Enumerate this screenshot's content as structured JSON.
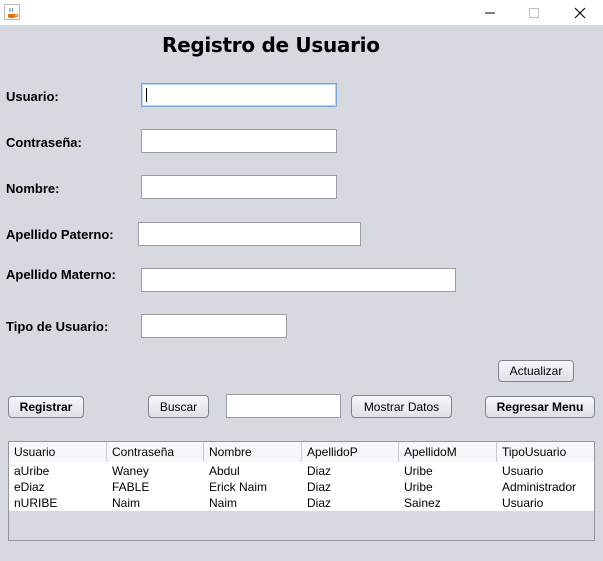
{
  "window": {
    "icon": "java-coffee-icon",
    "controls": [
      "minimize-icon",
      "maximize-icon",
      "close-icon"
    ]
  },
  "title": "Registro de Usuario",
  "form": {
    "usuario_label": "Usuario:",
    "usuario_value": "",
    "contrasena_label": "Contraseña:",
    "contrasena_value": "",
    "nombre_label": "Nombre:",
    "nombre_value": "",
    "apellido_paterno_label": "Apellido Paterno:",
    "apellido_paterno_value": "",
    "apellido_materno_label": "Apellido Materno:",
    "apellido_materno_value": "",
    "tipo_label": "Tipo de Usuario:",
    "tipo_value": "",
    "buscar_value": ""
  },
  "buttons": {
    "actualizar": "Actualizar",
    "registrar": "Registrar",
    "buscar": "Buscar",
    "mostrar": "Mostrar Datos",
    "regresar": "Regresar Menu"
  },
  "table": {
    "headers": [
      "Usuario",
      "Contraseña",
      "Nombre",
      "ApellidoP",
      "ApellidoM",
      "TipoUsuario"
    ],
    "rows": [
      [
        "aUribe",
        "Waney",
        "Abdul",
        "Diaz",
        "Uribe",
        "Usuario"
      ],
      [
        "eDiaz",
        "FABLE",
        "Erick Naim",
        "Diaz",
        "Uribe",
        "Administrador"
      ],
      [
        "nURIBE",
        "Naim",
        "Naim",
        "Diaz",
        "Sainez",
        "Usuario"
      ]
    ]
  },
  "colors": {
    "background": "#d6d9df",
    "focus_border": "#7aa7d6"
  }
}
